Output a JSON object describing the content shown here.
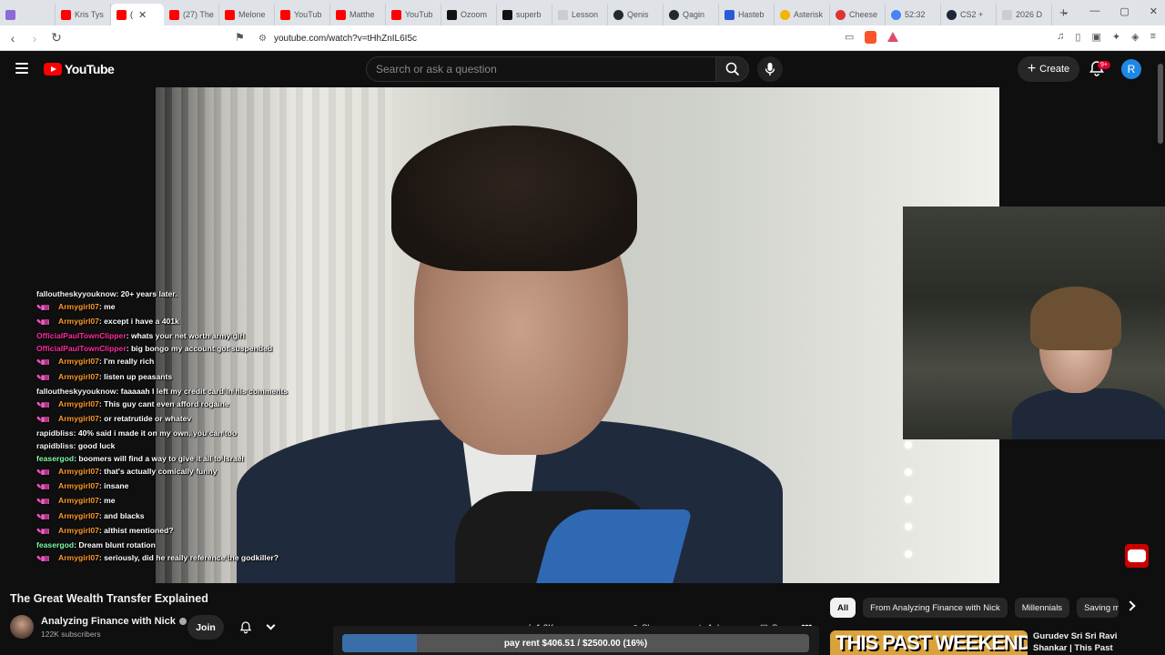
{
  "browser": {
    "tabs": [
      {
        "label": "",
        "icon": "purple"
      },
      {
        "label": "Kris Tys",
        "icon": "yt"
      },
      {
        "label": "(",
        "icon": "yt",
        "active": true
      },
      {
        "label": "(27) The",
        "icon": "yt"
      },
      {
        "label": "Melone",
        "icon": "yt"
      },
      {
        "label": "YouTub",
        "icon": "yt"
      },
      {
        "label": "Matthe",
        "icon": "yt"
      },
      {
        "label": "YouTub",
        "icon": "yt"
      },
      {
        "label": "Ozoom",
        "icon": "x"
      },
      {
        "label": "superb",
        "icon": "x"
      },
      {
        "label": "Lesson",
        "icon": "doc"
      },
      {
        "label": "Qenis",
        "icon": "gh"
      },
      {
        "label": "Qagin",
        "icon": "gh"
      },
      {
        "label": "Hasteb",
        "icon": "blue"
      },
      {
        "label": "Asterisk",
        "icon": "ast"
      },
      {
        "label": "Cheese",
        "icon": "red"
      },
      {
        "label": "52:32",
        "icon": "g"
      },
      {
        "label": "CS2 +",
        "icon": "steam"
      },
      {
        "label": "2026 D",
        "icon": "doc"
      }
    ],
    "new_tab_label": "+",
    "url": "youtube.com/watch?v=tHhZnIL6I5c"
  },
  "youtube": {
    "logo_text": "YouTube",
    "search_placeholder": "Search or ask a question",
    "create_label": "Create",
    "notification_badge": "9+",
    "avatar_letter": "R"
  },
  "chat": [
    {
      "user": "falloutheskyyouknow",
      "msg": "20+ years later.",
      "color": "white",
      "badges": false
    },
    {
      "user": "Armygirl07",
      "msg": "me",
      "color": "orange",
      "badges": true
    },
    {
      "user": "Armygirl07",
      "msg": "except i have a 401k",
      "color": "orange",
      "badges": true
    },
    {
      "user": "OfficialPaulTownClipper",
      "msg": "whats your net worth army girl",
      "color": "pink",
      "badges": false
    },
    {
      "user": "OfficialPaulTownClipper",
      "msg": "big bongo my account got suspended",
      "color": "pink",
      "badges": false
    },
    {
      "user": "Armygirl07",
      "msg": "I'm really rich",
      "color": "orange",
      "badges": true
    },
    {
      "user": "Armygirl07",
      "msg": "listen up peasants",
      "color": "orange",
      "badges": true
    },
    {
      "user": "falloutheskyyouknow",
      "msg": "faaaaah I left my credit card in his comments",
      "color": "white",
      "badges": false
    },
    {
      "user": "Armygirl07",
      "msg": "This guy cant even afford rogaine",
      "color": "orange",
      "badges": true
    },
    {
      "user": "Armygirl07",
      "msg": "or retatrutide or whatev",
      "color": "orange",
      "badges": true
    },
    {
      "user": "rapidbliss",
      "msg": "40% said i made it on my own, you can too",
      "color": "white",
      "badges": false
    },
    {
      "user": "rapidbliss",
      "msg": "good luck",
      "color": "white",
      "badges": false
    },
    {
      "user": "feasergod",
      "msg": "boomers will find a way to give it all to Israel",
      "color": "green",
      "badges": false
    },
    {
      "user": "Armygirl07",
      "msg": "that's actually comically funny",
      "color": "orange",
      "badges": true
    },
    {
      "user": "Armygirl07",
      "msg": "insane",
      "color": "orange",
      "badges": true
    },
    {
      "user": "Armygirl07",
      "msg": "me",
      "color": "orange",
      "badges": true
    },
    {
      "user": "Armygirl07",
      "msg": "and blacks",
      "color": "orange",
      "badges": true
    },
    {
      "user": "Armygirl07",
      "msg": "althist mentioned?",
      "color": "orange",
      "badges": true
    },
    {
      "user": "feasergod",
      "msg": "Dream blunt rotation",
      "color": "green",
      "badges": false
    },
    {
      "user": "Armygirl07",
      "msg": "seriously, did he really reference the godkiller?",
      "color": "orange",
      "badges": true
    }
  ],
  "video": {
    "title": "The Great Wealth Transfer Explained",
    "channel": "Analyzing Finance with Nick",
    "subscribers": "122K subscribers",
    "join_label": "Join",
    "like_count": "1.3K",
    "share_label": "Share",
    "ask_label": "Ask",
    "save_label": "Save"
  },
  "rent_overlay": {
    "text": "pay rent $406.51 / $2500.00 (16%)",
    "progress": 0.16
  },
  "chips": [
    {
      "label": "All",
      "active": true
    },
    {
      "label": "From Analyzing Finance with Nick",
      "active": false
    },
    {
      "label": "Millennials",
      "active": false
    },
    {
      "label": "Saving m",
      "active": false
    }
  ],
  "recommended": {
    "thumb_text": "THIS PAST WEEKEND",
    "title": "Gurudev Sri Sri Ravi Shankar | This Past Weekend w/ Theo"
  },
  "colors": {
    "yt_red": "#ff0000",
    "accent_blue": "#1e88e5",
    "progress_fill": "#3a6ea8"
  }
}
